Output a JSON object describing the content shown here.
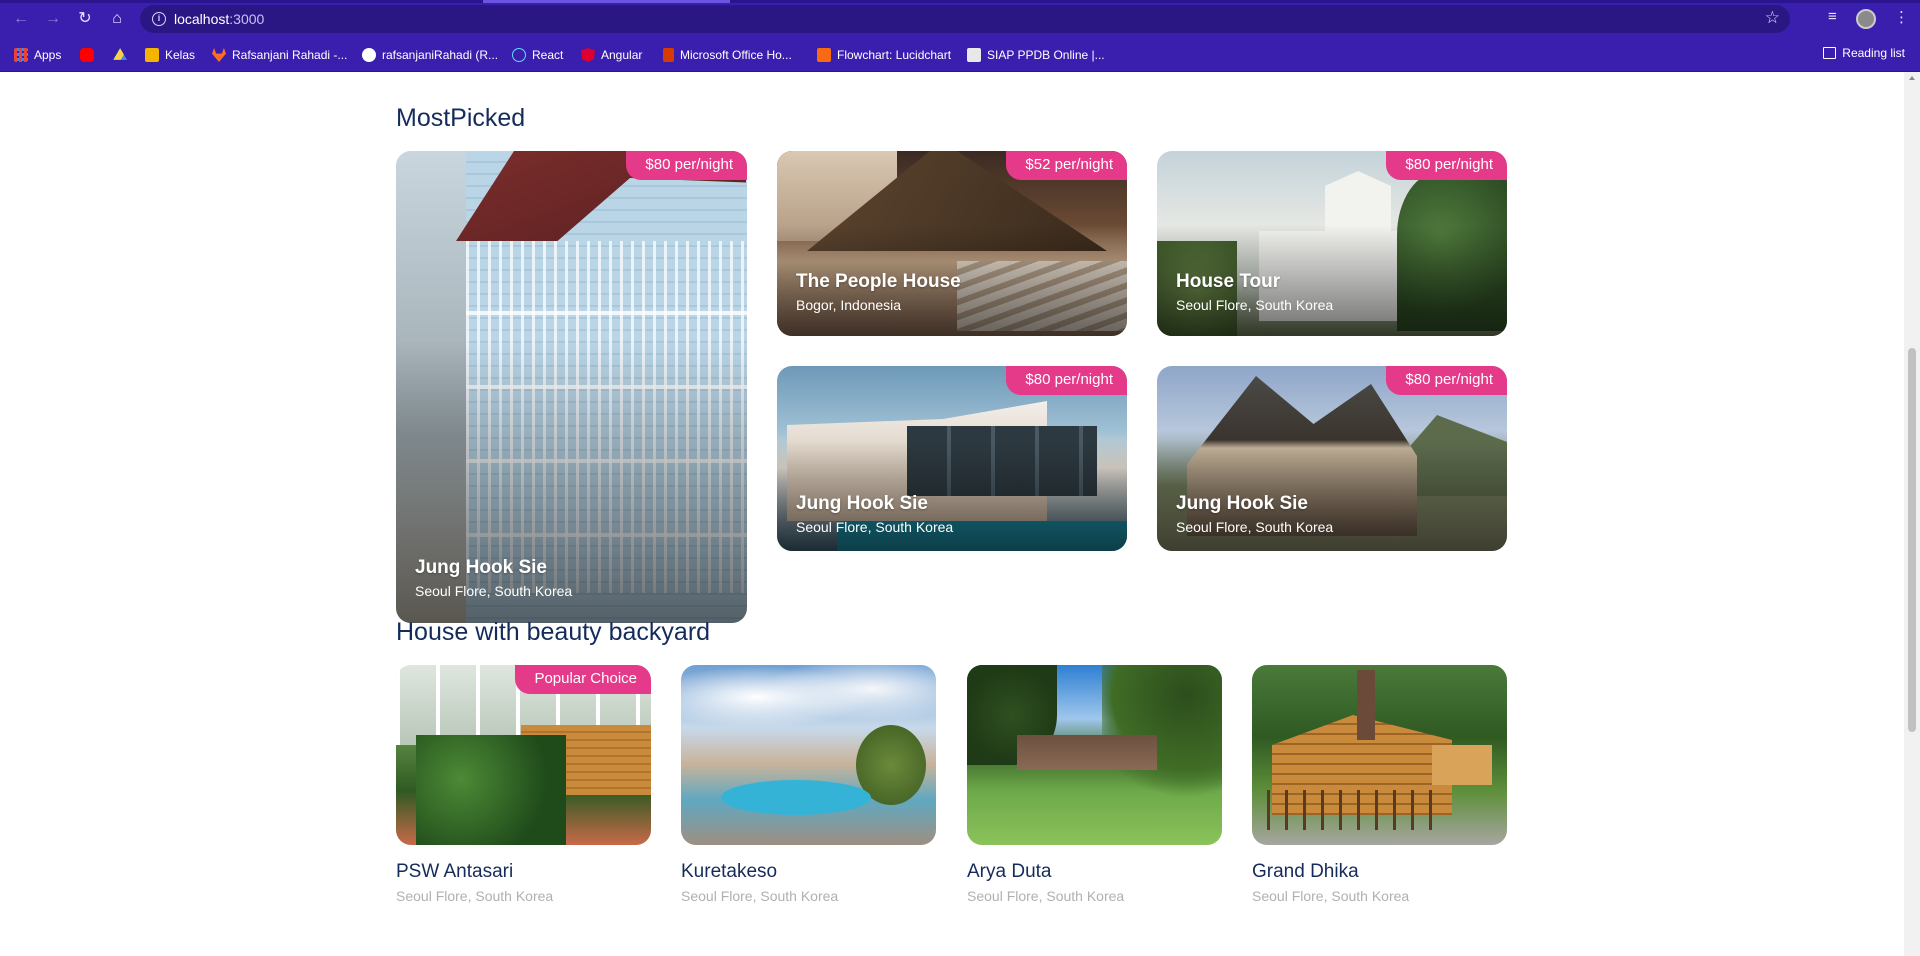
{
  "browser": {
    "url_host": "localhost",
    "url_port": ":3000",
    "bookmarks": [
      {
        "label": "Apps",
        "icon": "apps-grid-icon",
        "color": "#ea4335"
      },
      {
        "label": "",
        "icon": "youtube-icon",
        "color": "#ff0000"
      },
      {
        "label": "",
        "icon": "google-drive-icon",
        "color": "#1fa463"
      },
      {
        "label": "Kelas",
        "icon": "classroom-icon",
        "color": "#f4b400"
      },
      {
        "label": "Rafsanjani Rahadi -...",
        "icon": "gitlab-icon",
        "color": "#fc6d26"
      },
      {
        "label": "rafsanjaniRahadi (R...",
        "icon": "github-icon",
        "color": "#ffffff"
      },
      {
        "label": "React",
        "icon": "react-icon",
        "color": "#61dafb"
      },
      {
        "label": "Angular",
        "icon": "angular-icon",
        "color": "#dd0031"
      },
      {
        "label": "Microsoft Office Ho...",
        "icon": "office-icon",
        "color": "#d83b01"
      },
      {
        "label": "Flowchart: Lucidchart",
        "icon": "lucidchart-icon",
        "color": "#f96b13"
      },
      {
        "label": "SIAP PPDB Online |...",
        "icon": "siap-icon",
        "color": "#e8e8e8"
      }
    ],
    "reading_list": "Reading list"
  },
  "most_picked": {
    "title": "MostPicked",
    "items": [
      {
        "price": "$80 per/night",
        "name": "Jung Hook Sie",
        "location": "Seoul Flore, South Korea"
      },
      {
        "price": "$52 per/night",
        "name": "The People House",
        "location": "Bogor, Indonesia"
      },
      {
        "price": "$80 per/night",
        "name": "House Tour",
        "location": "Seoul Flore, South Korea"
      },
      {
        "price": "$80 per/night",
        "name": "Jung Hook Sie",
        "location": "Seoul Flore, South Korea"
      },
      {
        "price": "$80 per/night",
        "name": "Jung Hook Sie",
        "location": "Seoul Flore, South Korea"
      }
    ]
  },
  "backyard": {
    "title": "House with beauty backyard",
    "items": [
      {
        "badge": "Popular Choice",
        "name": "PSW Antasari",
        "location": "Seoul Flore, South Korea"
      },
      {
        "name": "Kuretakeso",
        "location": "Seoul Flore, South Korea"
      },
      {
        "name": "Arya Duta",
        "location": "Seoul Flore, South Korea"
      },
      {
        "name": "Grand Dhika",
        "location": "Seoul Flore, South Korea"
      }
    ]
  },
  "colors": {
    "accent": "#e5398a",
    "heading": "#152c5b",
    "muted": "#b0b0b0",
    "browser": "#3a1fae"
  }
}
